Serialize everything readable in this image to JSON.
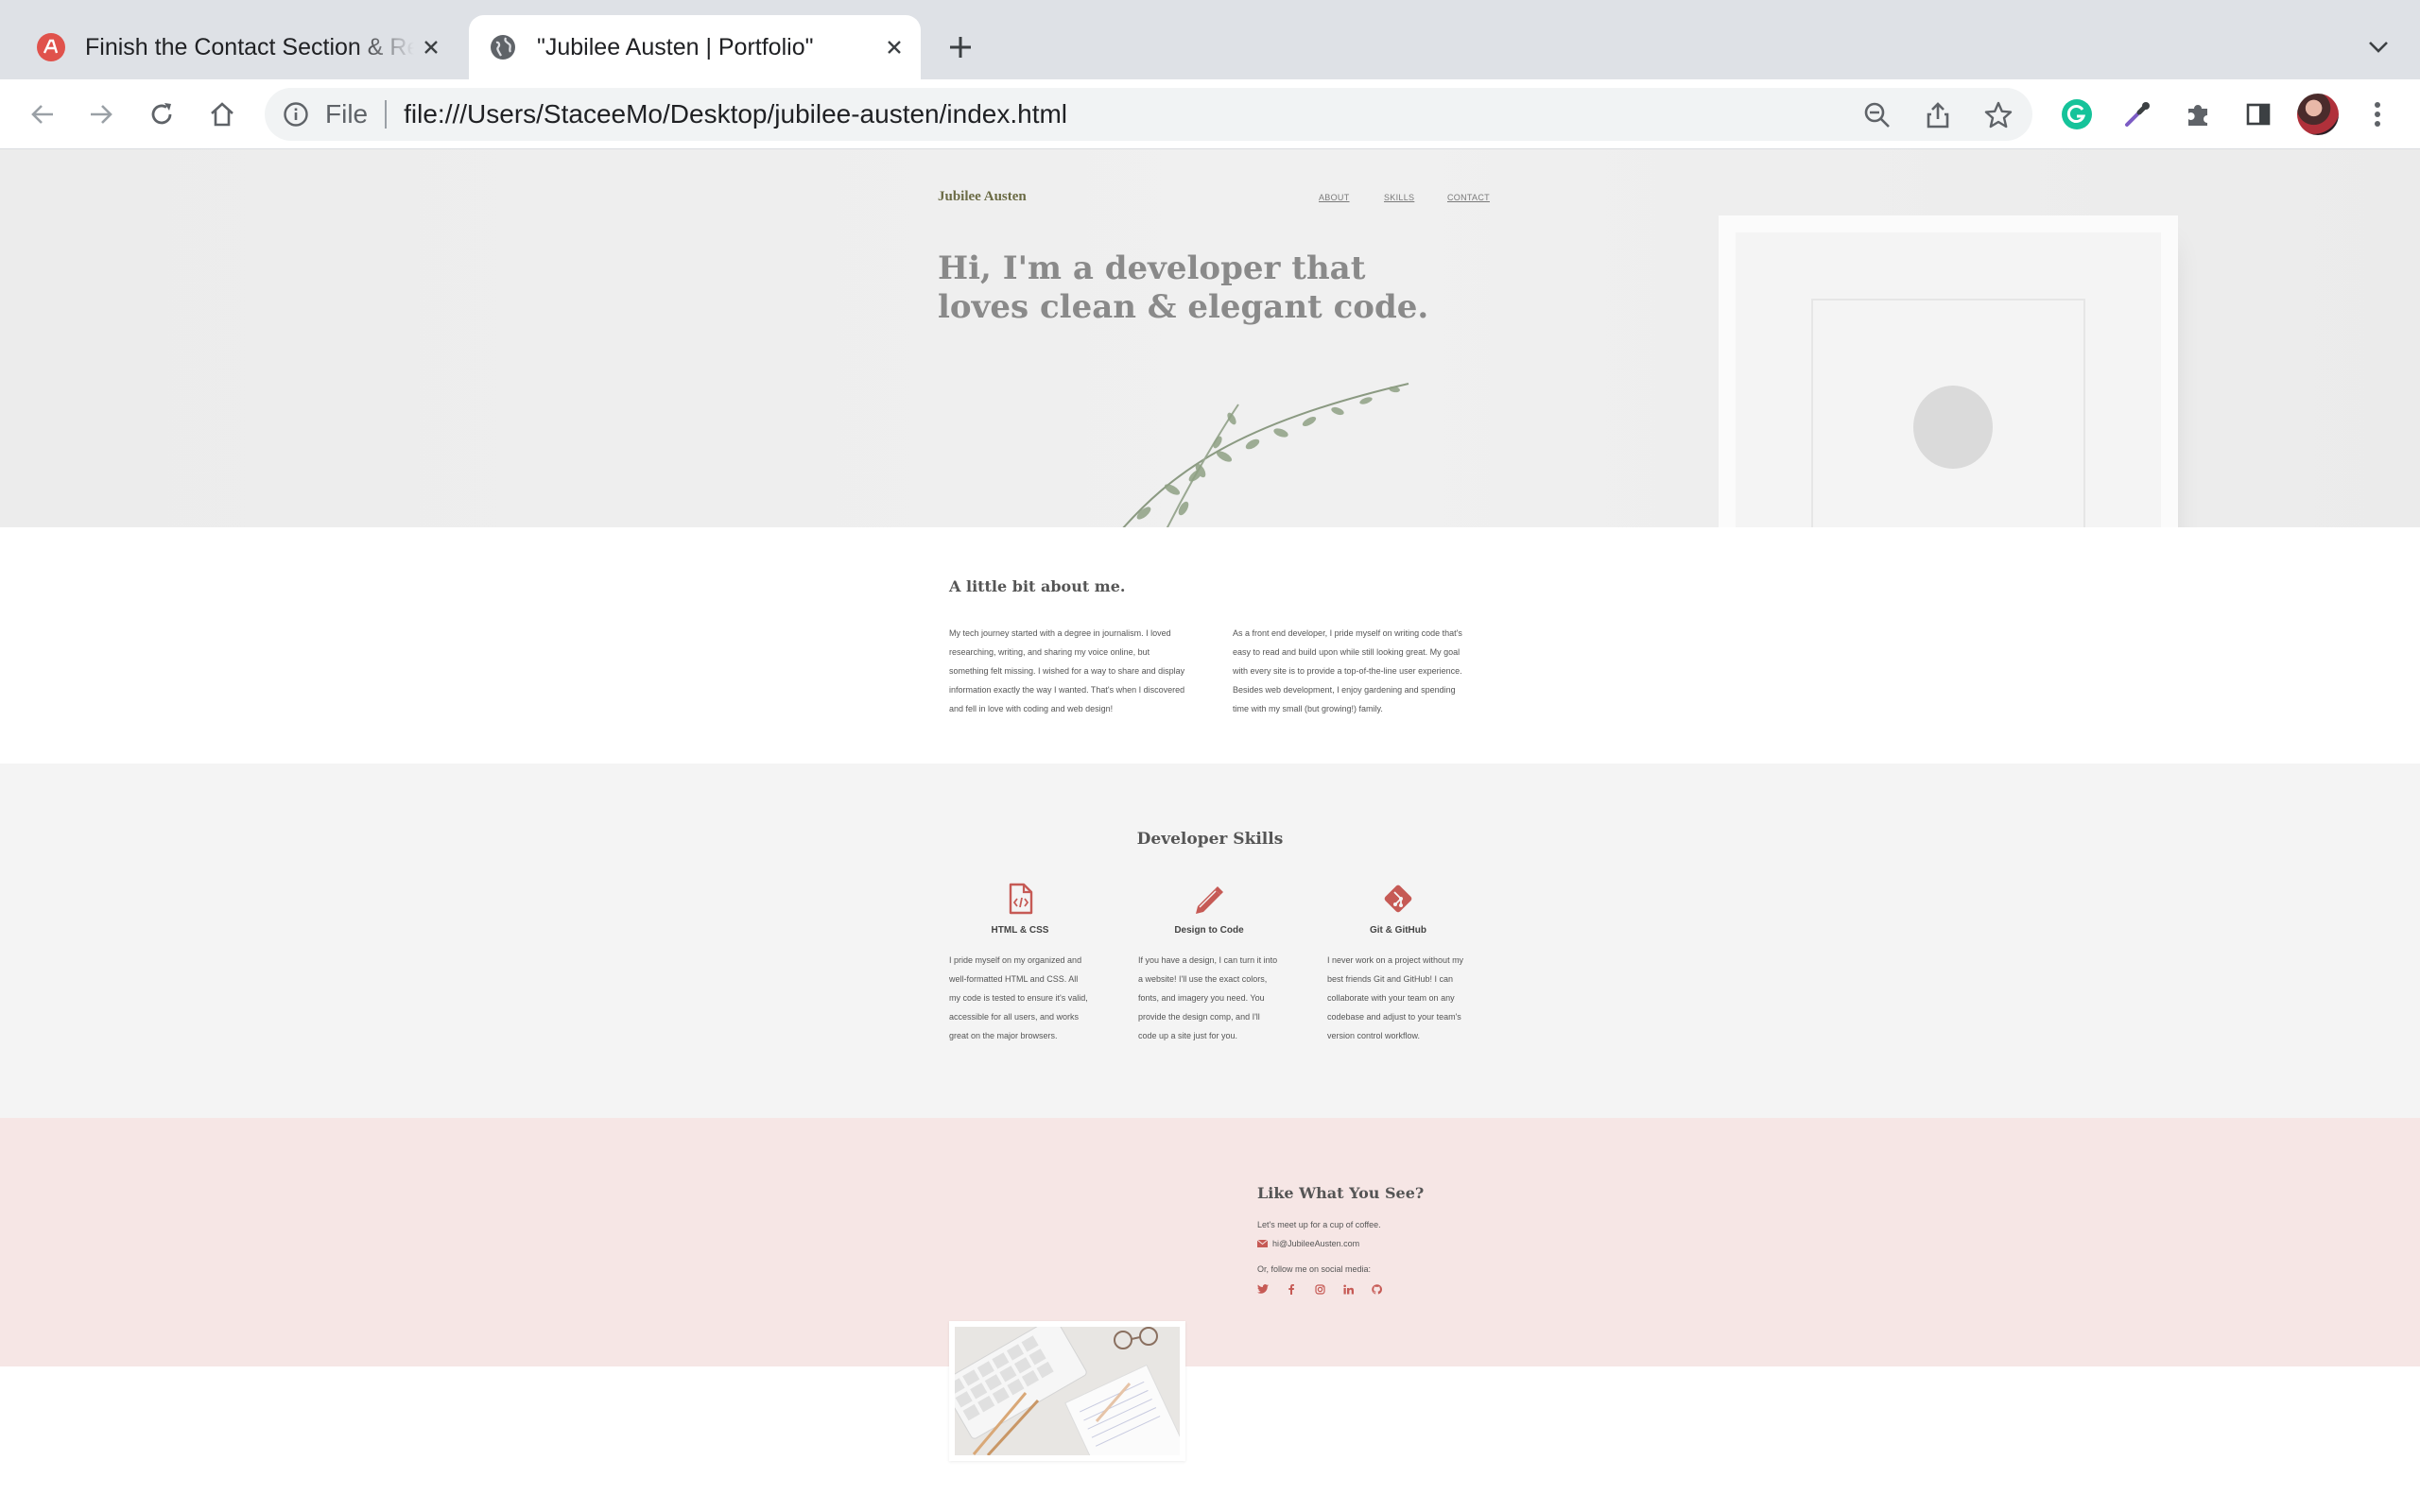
{
  "browser": {
    "tabs": [
      {
        "title": "Finish the Contact Section & Responsive Design",
        "active": false,
        "favicon": "app-logo-icon"
      },
      {
        "title": "\"Jubilee Austen | Portfolio\"",
        "active": true,
        "favicon": "globe-icon"
      }
    ],
    "address": {
      "scheme_label": "File",
      "url": "file:///Users/StaceeMo/Desktop/jubilee-austen/index.html"
    }
  },
  "site": {
    "nav": {
      "logo": "Jubilee Austen",
      "links": [
        "ABOUT",
        "SKILLS",
        "CONTACT"
      ]
    },
    "hero": {
      "title": "Hi, I'm a developer that loves clean & elegant code."
    },
    "about": {
      "heading": "A little bit about me.",
      "paragraphs": [
        "My tech journey started with a degree in journalism. I loved researching, writing, and sharing my voice online, but something felt missing. I wished for a way to share and display information exactly the way I wanted. That's when I discovered and fell in love with coding and web design!",
        "As a front end developer, I pride myself on writing code that's easy to read and build upon while still looking great. My goal with every site is to provide a top-of-the-line user experience. Besides web development, I enjoy gardening and spending time with my small (but growing!) family."
      ]
    },
    "skills": {
      "heading": "Developer Skills",
      "items": [
        {
          "title": "HTML & CSS",
          "icon": "code-file-icon",
          "text": "I pride myself on my organized and well-formatted HTML and CSS. All my code is tested to ensure it's valid, accessible for all users, and works great on the major browsers."
        },
        {
          "title": "Design to Code",
          "icon": "pencil-icon",
          "text": "If you have a design, I can turn it into a website! I'll use the exact colors, fonts, and imagery you need. You provide the design comp, and I'll code up a site just for you."
        },
        {
          "title": "Git & GitHub",
          "icon": "git-icon",
          "text": "I never work on a project without my best friends Git and GitHub! I can collaborate with your team on any codebase and adjust to your team's version control workflow."
        }
      ]
    },
    "contact": {
      "heading": "Like What You See?",
      "intro": "Let's meet up for a cup of coffee.",
      "email": "hi@JubileeAusten.com",
      "social_label": "Or, follow me on social media:",
      "socials": [
        "twitter-icon",
        "facebook-icon",
        "instagram-icon",
        "linkedin-icon",
        "github-icon"
      ]
    }
  },
  "colors": {
    "accent": "#c65a55",
    "logo": "#6b6b45",
    "hero_text": "#8a8a8a",
    "contact_bg": "#f6e6e5",
    "skills_bg": "#f4f4f4"
  }
}
